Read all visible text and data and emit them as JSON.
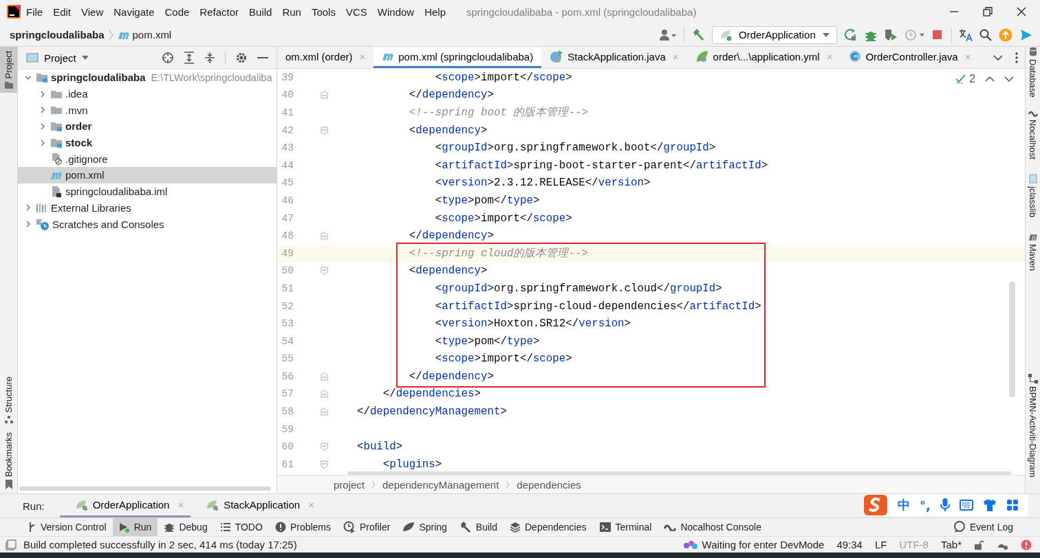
{
  "title_bar": {
    "menu": [
      "File",
      "Edit",
      "View",
      "Navigate",
      "Code",
      "Refactor",
      "Build",
      "Run",
      "Tools",
      "VCS",
      "Window",
      "Help"
    ],
    "title": "springcloudalibaba - pom.xml (springcloudalibaba)"
  },
  "nav_bar": {
    "breadcrumb": [
      "springcloudalibaba",
      "pom.xml"
    ],
    "run_config": "OrderApplication"
  },
  "left_stripe": [
    {
      "label": "Project",
      "selected": true
    },
    {
      "label": "Structure",
      "selected": false
    },
    {
      "label": "Bookmarks",
      "selected": false
    }
  ],
  "project_panel": {
    "title": "Project",
    "tree": [
      {
        "label": "springcloudalibaba",
        "note": "E:\\TLWork\\springcloudaliba",
        "kind": "module",
        "bold": true,
        "selected": false,
        "expanded": true,
        "children": [
          {
            "label": ".idea",
            "kind": "folder",
            "bold": false,
            "selected": false,
            "expanded": false
          },
          {
            "label": ".mvn",
            "kind": "folder",
            "bold": false,
            "selected": false,
            "expanded": false
          },
          {
            "label": "order",
            "kind": "module",
            "bold": true,
            "selected": false,
            "expanded": false
          },
          {
            "label": "stock",
            "kind": "module",
            "bold": true,
            "selected": false,
            "expanded": false
          },
          {
            "label": ".gitignore",
            "kind": "gitignore",
            "bold": false,
            "selected": false
          },
          {
            "label": "pom.xml",
            "kind": "maven",
            "bold": false,
            "selected": true
          },
          {
            "label": "springcloudalibaba.iml",
            "kind": "iml",
            "bold": false,
            "selected": false
          }
        ]
      },
      {
        "label": "External Libraries",
        "kind": "libraries",
        "bold": false,
        "selected": false,
        "expanded": false
      },
      {
        "label": "Scratches and Consoles",
        "kind": "scratches",
        "bold": false,
        "selected": false,
        "expanded": false
      }
    ]
  },
  "editor": {
    "tabs": [
      {
        "label": "om.xml (order)",
        "kind": "none",
        "selected": false,
        "close": "×"
      },
      {
        "label": "pom.xml (springcloudalibaba)",
        "kind": "maven",
        "selected": true
      },
      {
        "label": "StackApplication.java",
        "kind": "spring-class",
        "selected": false,
        "close": "×"
      },
      {
        "label": "order\\...\\application.yml",
        "kind": "spring-leaf",
        "selected": false,
        "close": "×"
      },
      {
        "label": "OrderController.java",
        "kind": "class",
        "selected": false,
        "close": "×"
      }
    ],
    "inspection_count": "2",
    "lines": [
      {
        "number": "39",
        "text": "                <scope>import</scope>",
        "current": false,
        "boxed": false,
        "fold_start": false,
        "fold_end": false
      },
      {
        "number": "40",
        "text": "            </dependency>",
        "current": false,
        "boxed": false,
        "fold_start": false,
        "fold_end": true
      },
      {
        "number": "41",
        "text": "            <!--spring boot 的版本管理-->",
        "current": false,
        "boxed": false,
        "fold_start": false,
        "fold_end": false
      },
      {
        "number": "42",
        "text": "            <dependency>",
        "current": false,
        "boxed": false,
        "fold_start": true,
        "fold_end": false
      },
      {
        "number": "43",
        "text": "                <groupId>org.springframework.boot</groupId>",
        "current": false,
        "boxed": false,
        "fold_start": false,
        "fold_end": false
      },
      {
        "number": "44",
        "text": "                <artifactId>spring-boot-starter-parent</artifactId>",
        "current": false,
        "boxed": false,
        "fold_start": false,
        "fold_end": false
      },
      {
        "number": "45",
        "text": "                <version>2.3.12.RELEASE</version>",
        "current": false,
        "boxed": false,
        "fold_start": false,
        "fold_end": false
      },
      {
        "number": "46",
        "text": "                <type>pom</type>",
        "current": false,
        "boxed": false,
        "fold_start": false,
        "fold_end": false
      },
      {
        "number": "47",
        "text": "                <scope>import</scope>",
        "current": false,
        "boxed": false,
        "fold_start": false,
        "fold_end": false
      },
      {
        "number": "48",
        "text": "            </dependency>",
        "current": false,
        "boxed": false,
        "fold_start": false,
        "fold_end": true
      },
      {
        "number": "49",
        "text": "            <!--spring cloud的版本管理-->",
        "current": true,
        "boxed": true,
        "fold_start": false,
        "fold_end": false
      },
      {
        "number": "50",
        "text": "            <dependency>",
        "current": false,
        "boxed": true,
        "fold_start": true,
        "fold_end": false
      },
      {
        "number": "51",
        "text": "                <groupId>org.springframework.cloud</groupId>",
        "current": false,
        "boxed": true,
        "fold_start": false,
        "fold_end": false
      },
      {
        "number": "52",
        "text": "                <artifactId>spring-cloud-dependencies</artifactId>",
        "current": false,
        "boxed": true,
        "fold_start": false,
        "fold_end": false
      },
      {
        "number": "53",
        "text": "                <version>Hoxton.SR12</version>",
        "current": false,
        "boxed": true,
        "fold_start": false,
        "fold_end": false
      },
      {
        "number": "54",
        "text": "                <type>pom</type>",
        "current": false,
        "boxed": true,
        "fold_start": false,
        "fold_end": false
      },
      {
        "number": "55",
        "text": "                <scope>import</scope>",
        "current": false,
        "boxed": true,
        "fold_start": false,
        "fold_end": false
      },
      {
        "number": "56",
        "text": "            </dependency>",
        "current": false,
        "boxed": true,
        "fold_start": false,
        "fold_end": true
      },
      {
        "number": "57",
        "text": "        </dependencies>",
        "current": false,
        "boxed": false,
        "fold_start": false,
        "fold_end": true
      },
      {
        "number": "58",
        "text": "    </dependencyManagement>",
        "current": false,
        "boxed": false,
        "fold_start": false,
        "fold_end": true
      },
      {
        "number": "59",
        "current": false,
        "boxed": false,
        "fold_start": false,
        "fold_end": false
      },
      {
        "number": "60",
        "text": "    <build>",
        "current": false,
        "boxed": false,
        "fold_start": true,
        "fold_end": false
      },
      {
        "number": "61",
        "text": "        <plugins>",
        "current": false,
        "boxed": false,
        "fold_start": true,
        "fold_end": false
      }
    ],
    "breadcrumb": [
      "project",
      "dependencyManagement",
      "dependencies"
    ]
  },
  "right_stripe": [
    {
      "label": "Database",
      "kind": "database"
    },
    {
      "label": "Nocalhost",
      "kind": "nocalhost"
    },
    {
      "label": "jclasslib",
      "kind": "jclasslib"
    },
    {
      "label": "Maven",
      "kind": "maven"
    },
    {
      "label": "BPMN-Activiti-Diagram",
      "kind": "bpmn"
    }
  ],
  "run_bar": {
    "label": "Run:",
    "tabs": [
      {
        "label": "OrderApplication",
        "selected": true,
        "close": "×"
      },
      {
        "label": "StackApplication",
        "selected": false,
        "close": "×"
      }
    ]
  },
  "ime": {
    "mode": "中",
    "punctuation": "°,"
  },
  "tool_windows": [
    {
      "label": "Version Control",
      "kind": "vcs",
      "selected": false
    },
    {
      "label": "Run",
      "kind": "run",
      "selected": true
    },
    {
      "label": "Debug",
      "kind": "debug",
      "selected": false
    },
    {
      "label": "TODO",
      "kind": "todo",
      "selected": false
    },
    {
      "label": "Problems",
      "kind": "problems",
      "selected": false
    },
    {
      "label": "Profiler",
      "kind": "profiler",
      "selected": false
    },
    {
      "label": "Spring",
      "kind": "spring",
      "selected": false
    },
    {
      "label": "Build",
      "kind": "build",
      "selected": false
    },
    {
      "label": "Dependencies",
      "kind": "dependencies",
      "selected": false
    },
    {
      "label": "Terminal",
      "kind": "terminal",
      "selected": false
    },
    {
      "label": "Nocalhost Console",
      "kind": "nocalhost",
      "selected": false
    }
  ],
  "event_log": "Event Log",
  "status_bar": {
    "message": "Build completed successfully in 2 sec, 414 ms (today 17:25)",
    "devmode": "Waiting for enter DevMode",
    "position": "49:34",
    "line_separator": "LF",
    "encoding": "UTF-8",
    "indent": "Tab*"
  }
}
